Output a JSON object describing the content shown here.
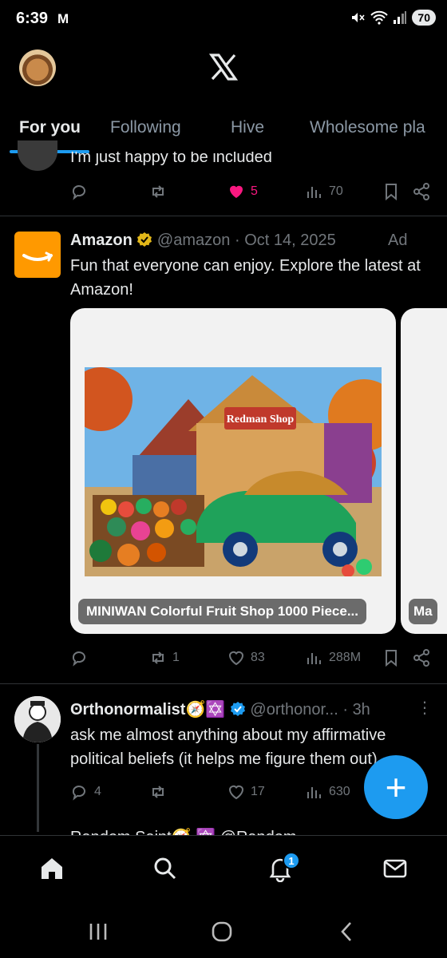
{
  "status_bar": {
    "time": "6:39",
    "mail_glyph": "M",
    "battery": "70"
  },
  "header": {
    "logo": "X"
  },
  "tabs": [
    {
      "label": "For you",
      "active": true
    },
    {
      "label": "Following",
      "active": false
    },
    {
      "label": "Hive",
      "active": false
    },
    {
      "label": "Wholesome pla",
      "active": false
    }
  ],
  "partial_tweet": {
    "text": "I'm just happy to be included",
    "likes": "5",
    "views": "70"
  },
  "ad_tweet": {
    "name": "Amazon",
    "handle": "@amazon",
    "separator": "·",
    "date": "Oct 14, 2025",
    "ad_label": "Ad",
    "text": "Fun that everyone can enjoy. Explore the latest at Amazon!",
    "card": {
      "image_sign": "Redman Shop",
      "label": "MINIWAN Colorful Fruit Shop 1000 Piece..."
    },
    "card2_label": "Ma",
    "reposts": "1",
    "likes": "83",
    "views": "288M"
  },
  "orth_tweet": {
    "name": "ʘrthonormalist🧭✡️",
    "handle": "@orthonor...",
    "separator": "·",
    "time": "3h",
    "text": "ask me almost anything about my affirmative political beliefs (it helps me figure them out)",
    "replies": "4",
    "likes": "17",
    "views": "630"
  },
  "next_tweet_peek": "Random Saint🧭 ✡️ @Random...",
  "fab": {
    "label": "+"
  },
  "bottom_nav": {
    "notifications_badge": "1"
  },
  "colors": {
    "accent": "#1d9bf0",
    "like": "#f91880",
    "background": "#000000",
    "muted": "#71767b"
  }
}
